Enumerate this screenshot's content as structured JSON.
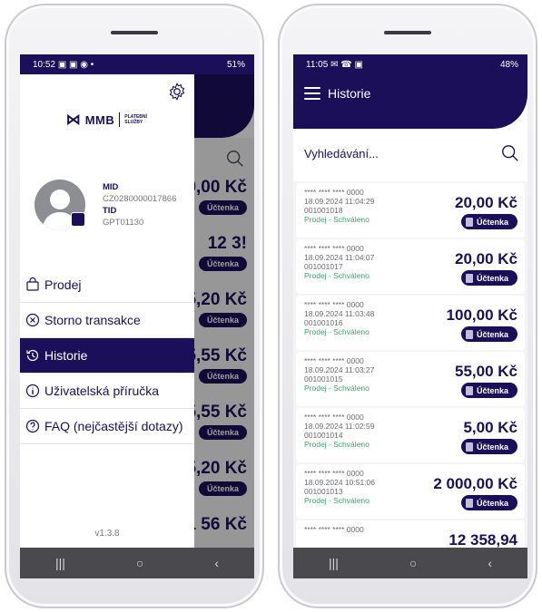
{
  "left_screen": {
    "status": {
      "time": "10:52",
      "icons": "▣ ▣ ◉ •",
      "signal": "51%"
    },
    "background": {
      "amounts": [
        "0,00 Kč",
        "12 3!",
        "5,20 Kč",
        "5,55 Kč",
        "5,55 Kč",
        "5,20 Kč",
        "1 56 Kč"
      ],
      "receipt_label": "Účtenka"
    },
    "drawer": {
      "logo": {
        "mark": "⋈",
        "name": "MMB",
        "sub": "PLATEBNÍ SLUŽBY"
      },
      "mid_label": "MID",
      "mid_value": "CZ0280000017866",
      "tid_label": "TID",
      "tid_value": "GPT01130",
      "menu": [
        {
          "label": "Prodej",
          "icon": "bag-icon"
        },
        {
          "label": "Storno transakce",
          "icon": "cancel-circle-icon"
        },
        {
          "label": "Historie",
          "icon": "history-icon",
          "active": true
        },
        {
          "label": "Uživatelská příručka",
          "icon": "info-icon"
        },
        {
          "label": "FAQ (nejčastější dotazy)",
          "icon": "question-icon"
        }
      ],
      "version": "v1.3.8"
    }
  },
  "right_screen": {
    "status": {
      "time": "11:05",
      "icons": "✉ ☎ ▣",
      "signal": "48%"
    },
    "title": "Historie",
    "search_placeholder": "Vyhledávání...",
    "receipt_label": "Účtenka",
    "transactions": [
      {
        "card": "**** **** **** 0000",
        "datetime": "18.09.2024 11:04:29",
        "id": "001001018",
        "status": "Prodej - Schváleno",
        "amount": "20,00 Kč"
      },
      {
        "card": "**** **** **** 0000",
        "datetime": "18.09.2024 11:04:07",
        "id": "001001017",
        "status": "Prodej - Schváleno",
        "amount": "20,00 Kč"
      },
      {
        "card": "**** **** **** 0000",
        "datetime": "18.09.2024 11:03:48",
        "id": "001001016",
        "status": "Prodej - Schváleno",
        "amount": "100,00 Kč"
      },
      {
        "card": "**** **** **** 0000",
        "datetime": "18.09.2024 11:03:27",
        "id": "001001015",
        "status": "Prodej - Schváleno",
        "amount": "55,00 Kč"
      },
      {
        "card": "**** **** **** 0000",
        "datetime": "18.09.2024 11:02:59",
        "id": "001001014",
        "status": "Prodej - Schváleno",
        "amount": "5,00 Kč"
      },
      {
        "card": "**** **** **** 0000",
        "datetime": "18.09.2024 10:51:06",
        "id": "001001013",
        "status": "Prodej - Schváleno",
        "amount": "2 000,00 Kč"
      },
      {
        "card": "**** **** **** 0000",
        "datetime": "",
        "id": "",
        "status": "",
        "amount": "12 358,94"
      }
    ]
  },
  "nav": {
    "recents": "|||",
    "home": "○",
    "back": "‹"
  },
  "colors": {
    "brand": "#1c0f59",
    "approved": "#3fa36b"
  }
}
